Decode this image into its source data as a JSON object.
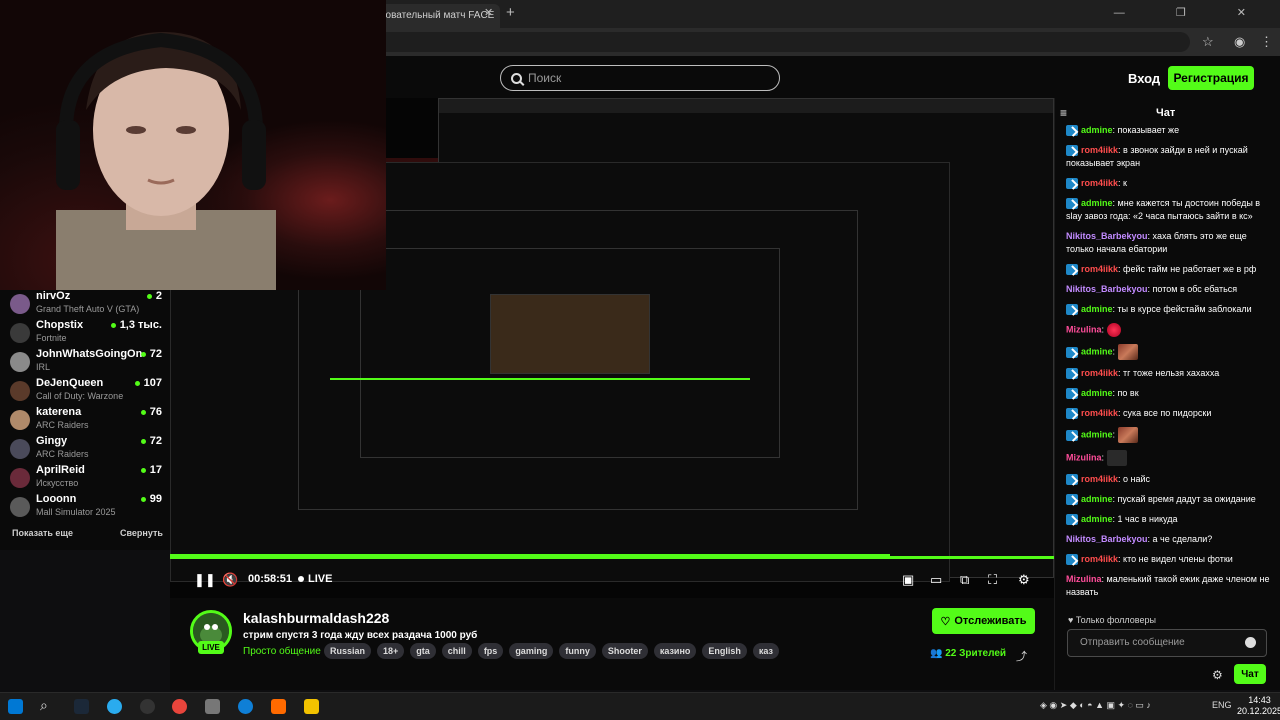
{
  "browser": {
    "tab_title": "новательный матч FACE",
    "tab_close": "✕",
    "new_tab": "+",
    "window_controls": "— ❐ ✕"
  },
  "header": {
    "search_placeholder": "Поиск",
    "login_label": "Вход",
    "register_label": "Регистрация"
  },
  "sidebar": {
    "channels": [
      {
        "name": "nirvOz",
        "game": "Grand Theft Auto V (GTA)",
        "viewers": "2",
        "avatar_color": "#7a5a8a"
      },
      {
        "name": "Chopstix",
        "game": "Fortnite",
        "viewers": "1,3 тыс.",
        "avatar_color": "#3a3a3a"
      },
      {
        "name": "JohnWhatsGoingOn",
        "game": "IRL",
        "viewers": "72",
        "avatar_color": "#8a8a8a"
      },
      {
        "name": "DeJenQueen",
        "game": "Call of Duty: Warzone",
        "viewers": "107",
        "avatar_color": "#5a3a2a"
      },
      {
        "name": "katerena",
        "game": "ARC Raiders",
        "viewers": "76",
        "avatar_color": "#b08a6a"
      },
      {
        "name": "Gingy",
        "game": "ARC Raiders",
        "viewers": "72",
        "avatar_color": "#4a4a5a"
      },
      {
        "name": "AprilReid",
        "game": "Искусство",
        "viewers": "17",
        "avatar_color": "#6a2a3a"
      },
      {
        "name": "Looonn",
        "game": "Mall Simulator 2025",
        "viewers": "99",
        "avatar_color": "#5a5a5a"
      }
    ],
    "show_more": "Показать еще",
    "collapse": "Свернуть"
  },
  "player": {
    "time": "00:58:51",
    "live_label": "LIVE"
  },
  "stream": {
    "streamer_name": "kalashburmaldash228",
    "title": "стрим спустя 3 года жду всех раздача 1000 руб",
    "category": "Просто общение",
    "tags": [
      "Russian",
      "18+",
      "gta",
      "chill",
      "fps",
      "gaming",
      "funny",
      "Shooter",
      "казино",
      "English",
      "каз"
    ],
    "live_badge": "LIVE",
    "follow_label": "Отслеживать",
    "viewers_count": "22",
    "viewers_label": "Зрителей"
  },
  "chat": {
    "title": "Чат",
    "messages": [
      {
        "user": "admine",
        "cls": "u-admine",
        "text": "показывает же"
      },
      {
        "user": "rom4iikk",
        "cls": "u-rom",
        "text": "в звонок зайди в ней и пускай показывает экран"
      },
      {
        "user": "rom4iikk",
        "cls": "u-rom",
        "text": "к"
      },
      {
        "user": "admine",
        "cls": "u-admine",
        "text": "мне кажется ты достоин победы в slay завоз года: «2 часа пытаюсь зайти в кс»"
      },
      {
        "user": "Nikitos_Barbekyou",
        "cls": "u-nik",
        "text": "хаха блять это же еще только начала ебатории"
      },
      {
        "user": "rom4iikk",
        "cls": "u-rom",
        "text": "фейс тайм не работает же в рф"
      },
      {
        "user": "Nikitos_Barbekyou",
        "cls": "u-nik",
        "text": "потом в обс ебаться"
      },
      {
        "user": "admine",
        "cls": "u-admine",
        "text": "ты в курсе фейстайм заблокали"
      },
      {
        "user": "Mizulina",
        "cls": "u-miz",
        "text": "",
        "emote": "red"
      },
      {
        "user": "admine",
        "cls": "u-admine",
        "text": "",
        "emote": "face"
      },
      {
        "user": "rom4iikk",
        "cls": "u-rom",
        "text": "тг тоже нельзя хахахха"
      },
      {
        "user": "admine",
        "cls": "u-admine",
        "text": "по вк"
      },
      {
        "user": "rom4iikk",
        "cls": "u-rom",
        "text": "сука все по пидорски"
      },
      {
        "user": "admine",
        "cls": "u-admine",
        "text": "",
        "emote": "face"
      },
      {
        "user": "Mizulina",
        "cls": "u-miz",
        "text": "",
        "emote": "dark"
      },
      {
        "user": "rom4iikk",
        "cls": "u-rom",
        "text": "о найс"
      },
      {
        "user": "admine",
        "cls": "u-admine",
        "text": "пускай время дадут за ожидание"
      },
      {
        "user": "admine",
        "cls": "u-admine",
        "text": "1 час в никуда"
      },
      {
        "user": "Nikitos_Barbekyou",
        "cls": "u-nik",
        "text": "а че сделали?"
      },
      {
        "user": "rom4iikk",
        "cls": "u-rom",
        "text": "кто не видел члены фотки"
      },
      {
        "user": "Mizulina",
        "cls": "u-miz",
        "text": "маленький такой ежик даже членом не назвать"
      }
    ],
    "followers_only": "Только фолловеры",
    "input_placeholder": "Отправить сообщение",
    "send_label": "Чат"
  },
  "taskbar": {
    "lang": "ENG",
    "time": "14:43",
    "date": "20.12.2025"
  }
}
